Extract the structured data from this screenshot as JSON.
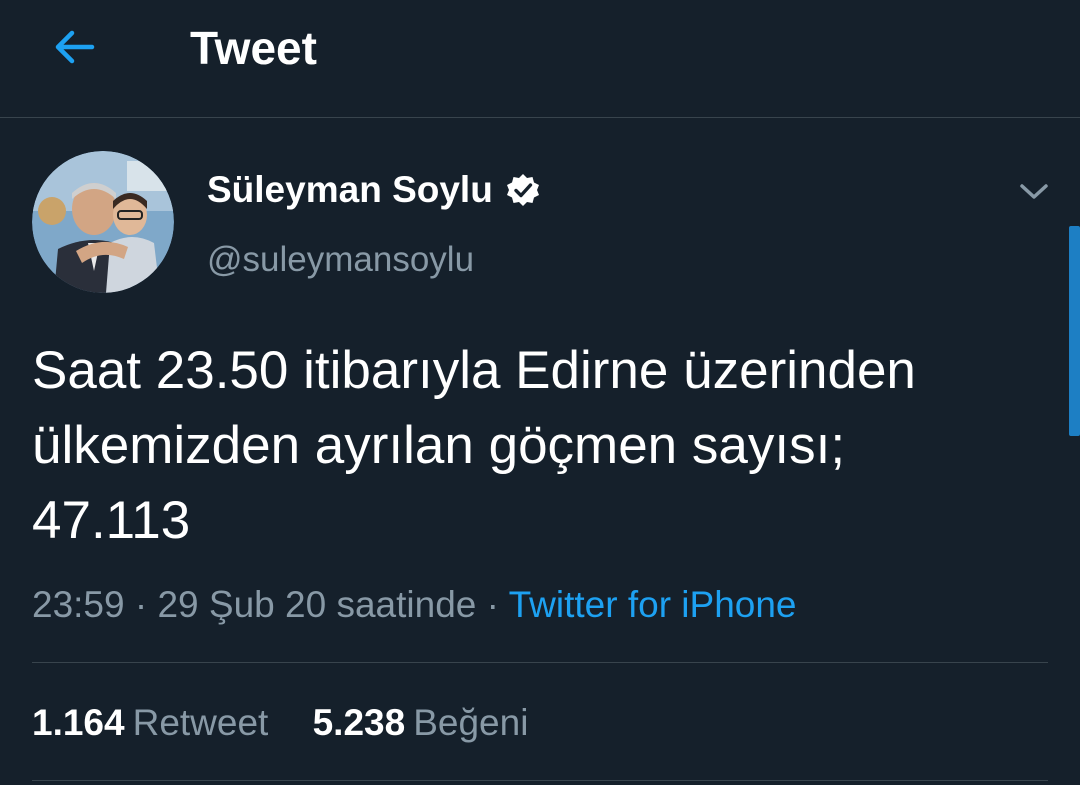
{
  "header": {
    "title": "Tweet",
    "back_icon": "arrow-left-icon"
  },
  "author": {
    "display_name": "Süleyman Soylu",
    "handle": "@suleymansoylu",
    "verified_icon": "verified-badge-icon"
  },
  "tweet": {
    "text": "Saat 23.50 itibarıyla Edirne üzerinden\nülkemizden ayrılan göçmen sayısı;\n47.113"
  },
  "meta": {
    "time": "23:59",
    "separator": "·",
    "date": "29 Şub 20 saatinde",
    "source": "Twitter for iPhone"
  },
  "stats": {
    "retweet_count": "1.164",
    "retweet_label": "Retweet",
    "like_count": "5.238",
    "like_label": "Beğeni"
  },
  "colors": {
    "background": "#15202b",
    "accent": "#1da1f2",
    "secondary_text": "#8899a6",
    "divider": "#38444d"
  }
}
